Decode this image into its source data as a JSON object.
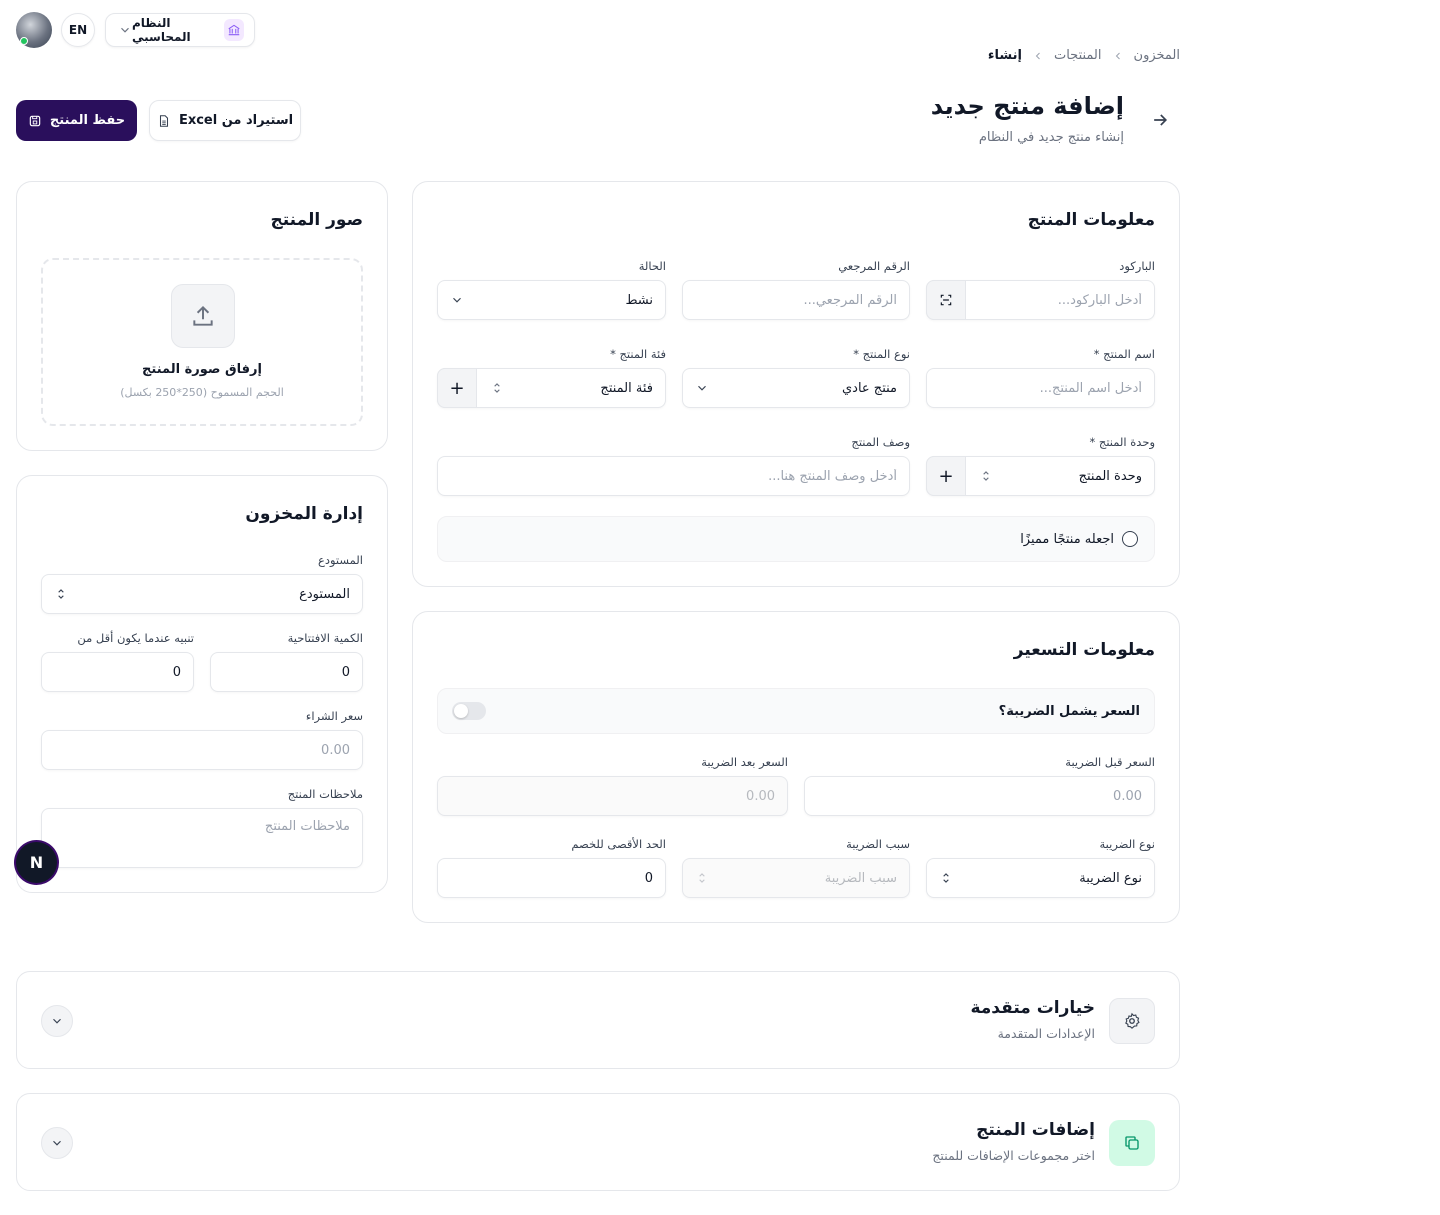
{
  "topbar": {
    "lang": "EN",
    "system_label": "النظام المحاسبي",
    "icons": [
      "avatar",
      "bank-icon",
      "chevron-down-icon"
    ]
  },
  "breadcrumb": {
    "items": [
      "المخزون",
      "المنتجات",
      "إنشاء"
    ]
  },
  "header": {
    "title": "إضافة منتج جديد",
    "subtitle": "إنشاء منتج جديد في النظام",
    "save_label": "حفظ المنتج",
    "import_label": "استيراد من Excel"
  },
  "product_info": {
    "title": "معلومات المنتج",
    "barcode": {
      "label": "الباركود",
      "placeholder": "أدخل الباركود..."
    },
    "reference": {
      "label": "الرقم المرجعي",
      "placeholder": "الرقم المرجعي..."
    },
    "status": {
      "label": "الحالة",
      "value": "نشط"
    },
    "name": {
      "label": "اسم المنتج *",
      "placeholder": "أدخل اسم المنتج..."
    },
    "type": {
      "label": "نوع المنتج *",
      "value": "منتج عادي"
    },
    "category": {
      "label": "فئة المنتج *",
      "value": "فئة المنتج"
    },
    "unit": {
      "label": "وحدة المنتج *",
      "value": "وحدة المنتج"
    },
    "description": {
      "label": "وصف المنتج",
      "placeholder": "أدخل وصف المنتج هنا..."
    },
    "featured_label": "اجعله منتجًا مميزًا"
  },
  "pricing": {
    "title": "معلومات التسعير",
    "tax_inclusive_label": "السعر يشمل الضريبة؟",
    "price_before": {
      "label": "السعر قبل الضريبة",
      "placeholder": "0.00"
    },
    "price_after": {
      "label": "السعر بعد الضريبة",
      "placeholder": "0.00"
    },
    "tax_type": {
      "label": "نوع الضريبة",
      "value": "نوع الضريبة"
    },
    "tax_reason": {
      "label": "سبب الضريبة",
      "value": "سبب الضريبة"
    },
    "max_discount": {
      "label": "الحد الأقصى للخصم",
      "value": "0"
    }
  },
  "images": {
    "title": "صور المنتج",
    "upload_title": "إرفاق صورة المنتج",
    "upload_hint": "الحجم المسموح (250*250 بكسل)"
  },
  "inventory": {
    "title": "إدارة المخزون",
    "warehouse": {
      "label": "المستودع",
      "value": "المستودع"
    },
    "opening_qty": {
      "label": "الكمية الافتتاحية",
      "value": "0"
    },
    "alert_below": {
      "label": "تنبيه عندما يكون أقل من",
      "value": "0"
    },
    "purchase_price": {
      "label": "سعر الشراء",
      "placeholder": "0.00"
    },
    "notes": {
      "label": "ملاحظات المنتج",
      "placeholder": "ملاحظات المنتج"
    }
  },
  "fab_letter": "N",
  "advanced": {
    "title": "خيارات متقدمة",
    "subtitle": "الإعدادات المتقدمة"
  },
  "addons": {
    "title": "إضافات المنتج",
    "subtitle": "اختر مجموعات الإضافات للمنتج"
  },
  "colors": {
    "primary": "#2a0f5c",
    "addon_icon_bg": "#d1fae5",
    "addon_icon": "#059669"
  }
}
